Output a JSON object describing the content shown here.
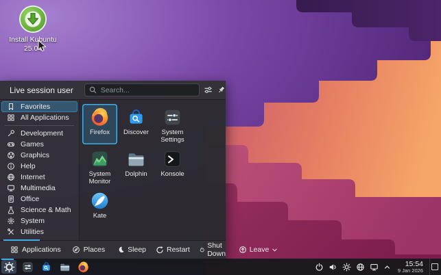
{
  "colors": {
    "accent": "#3daee9"
  },
  "desktop": {
    "install_label_line1": "Install Kubuntu",
    "install_label_line2": "25.04"
  },
  "launcher": {
    "user_name": "Live session user",
    "search_placeholder": "Search...",
    "sidebar": [
      {
        "label": "Favorites",
        "icon": "bookmark-icon",
        "selected": true
      },
      {
        "label": "All Applications",
        "icon": "grid-icon"
      },
      {
        "label": "Development",
        "icon": "wrench-icon"
      },
      {
        "label": "Games",
        "icon": "gamepad-icon"
      },
      {
        "label": "Graphics",
        "icon": "palette-icon"
      },
      {
        "label": "Help",
        "icon": "help-icon"
      },
      {
        "label": "Internet",
        "icon": "globe-icon"
      },
      {
        "label": "Multimedia",
        "icon": "screen-icon"
      },
      {
        "label": "Office",
        "icon": "document-icon"
      },
      {
        "label": "Science & Math",
        "icon": "flask-icon"
      },
      {
        "label": "System",
        "icon": "gear-icon"
      },
      {
        "label": "Utilities",
        "icon": "tools-icon"
      }
    ],
    "apps": [
      {
        "label": "Firefox",
        "selected": true
      },
      {
        "label": "Discover"
      },
      {
        "label": "System Settings"
      },
      {
        "label": "System Monitor"
      },
      {
        "label": "Dolphin"
      },
      {
        "label": "Konsole"
      },
      {
        "label": "Kate"
      }
    ],
    "tabs": [
      {
        "label": "Applications",
        "icon": "grid-icon",
        "active": true
      },
      {
        "label": "Places",
        "icon": "compass-icon"
      }
    ],
    "power": [
      {
        "label": "Sleep",
        "icon": "moon-icon"
      },
      {
        "label": "Restart",
        "icon": "restart-icon"
      },
      {
        "label": "Shut Down",
        "icon": "power-icon"
      },
      {
        "label": "Leave",
        "icon": "leave-icon"
      }
    ]
  },
  "taskbar": {
    "time": "15:54",
    "date": "9 Jan 2026",
    "tray_icons": [
      "power-management-icon",
      "volume-icon",
      "brightness-icon",
      "network-icon",
      "display-icon",
      "expand-tray-icon"
    ]
  }
}
